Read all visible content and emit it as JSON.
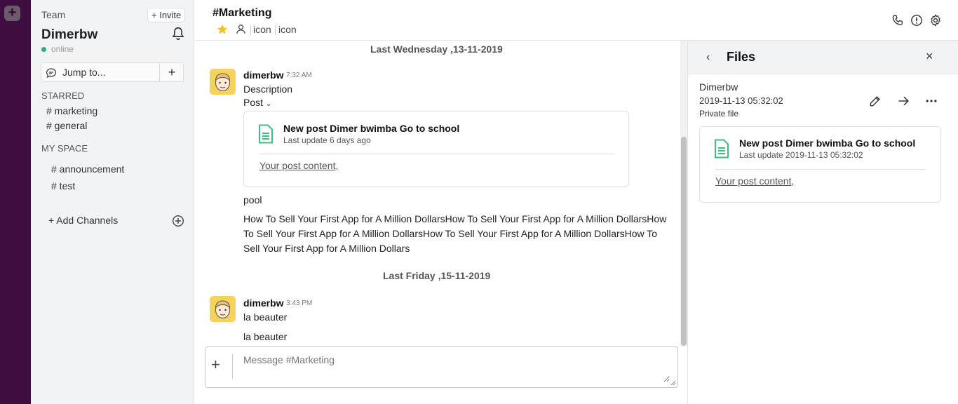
{
  "sidebar": {
    "team_label": "Team",
    "invite_label": "+ Invite",
    "user_name": "Dimerbw",
    "status": "online",
    "jump_label": "Jump to...",
    "jump_plus": "+",
    "starred_title": "STARRED",
    "starred": [
      "# marketing",
      "# general"
    ],
    "myspace_title": "MY SPACE",
    "myspace": [
      "# announcement",
      "# test"
    ],
    "add_channels": "+ Add Channels"
  },
  "header": {
    "channel_title": "#Marketing",
    "icon_text_1": "icon",
    "icon_text_2": "icon"
  },
  "messages": [
    {
      "date": "Last Wednesday ,13-11-2019",
      "user": "dimerbw",
      "time": "7:32 AM",
      "description": "Description",
      "post_label": "Post",
      "card": {
        "title": "New post Dimer bwimba Go to school",
        "sub": "Last update 6 days ago",
        "content": "Your post content,"
      },
      "line1": "pool",
      "long_text": "How To Sell Your First App for A Million DollarsHow To Sell Your First App for A Million DollarsHow To Sell Your First App for A Million DollarsHow To Sell Your First App for A Million DollarsHow To Sell Your First App for A Million Dollars"
    },
    {
      "date": "Last Friday ,15-11-2019",
      "user": "dimerbw",
      "time": "3:43 PM",
      "text1": "la beauter",
      "text2": "la beauter"
    }
  ],
  "composer": {
    "placeholder": "Message #Marketing",
    "plus": "+"
  },
  "panel": {
    "title": "Files",
    "back": "‹",
    "close": "×",
    "file_owner": "Dimerbw",
    "file_date": "2019-11-13 05:32:02",
    "file_private": "Private file",
    "card": {
      "title": "New post Dimer bwimba Go to school",
      "sub": "Last update 2019-11-13 05:32:02",
      "content": "Your post content,"
    }
  },
  "colors": {
    "rail": "#3f0e40",
    "sidebar": "#f2f3f5",
    "online": "#2bac76",
    "star": "#f2c230",
    "doc_icon": "#3fbf7f"
  },
  "icons": [
    "bell-icon",
    "chat-icon",
    "plus-circle-icon",
    "star-icon",
    "person-icon",
    "phone-icon",
    "info-icon",
    "gear-icon",
    "doc-icon",
    "edit-icon",
    "share-icon",
    "more-icon",
    "back-icon",
    "close-icon"
  ]
}
